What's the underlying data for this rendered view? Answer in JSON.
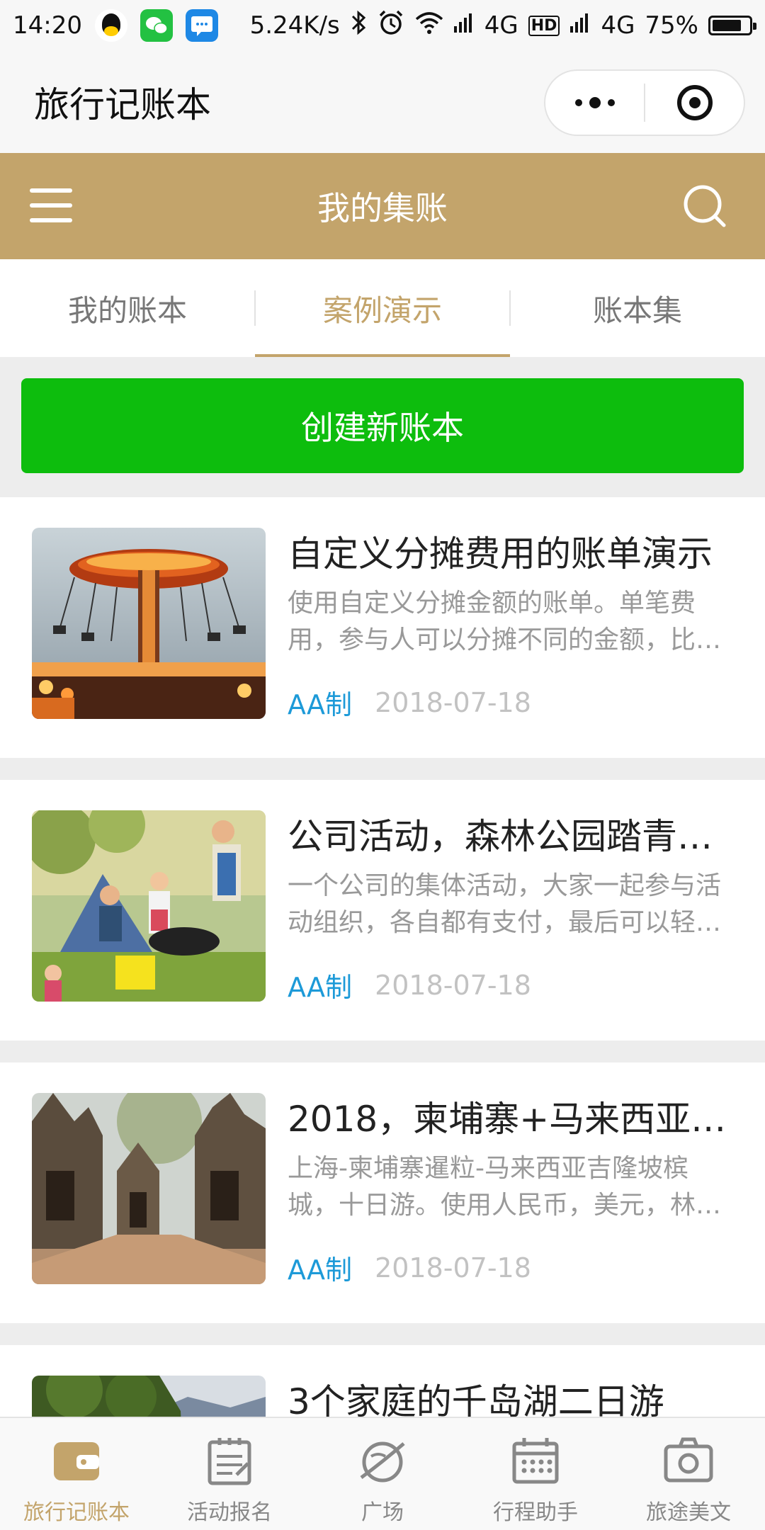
{
  "status_bar": {
    "time": "14:20",
    "net_speed": "5.24K/s",
    "network1": "4G",
    "hd_badge": "HD",
    "network2": "4G",
    "battery": "75%"
  },
  "mini_program": {
    "title": "旅行记账本"
  },
  "header": {
    "title": "我的集账"
  },
  "tabs": [
    {
      "label": "我的账本",
      "active": false
    },
    {
      "label": "案例演示",
      "active": true
    },
    {
      "label": "账本集",
      "active": false
    }
  ],
  "create_button": {
    "label": "创建新账本"
  },
  "cards": [
    {
      "title": "自定义分摊费用的账单演示",
      "desc": "使用自定义分摊金额的账单。单笔费用，参与人可以分摊不同的金额，比…",
      "tag": "AA制",
      "date": "2018-07-18",
      "image": "carnival-swing-ride"
    },
    {
      "title": "公司活动，森林公园踏青…",
      "desc": "一个公司的集体活动，大家一起参与活动组织，各自都有支付，最后可以轻…",
      "tag": "AA制",
      "date": "2018-07-18",
      "image": "family-picnic-bbq"
    },
    {
      "title": "2018，柬埔寨+马来西亚…",
      "desc": "上海-柬埔寨暹粒-马来西亚吉隆坡槟城，十日游。使用人民币，美元，林…",
      "tag": "AA制",
      "date": "2018-07-18",
      "image": "angkor-temple-ruins"
    },
    {
      "title": "3个家庭的千岛湖二日游",
      "desc": "",
      "tag": "",
      "date": "",
      "image": "lake-mountain-forest"
    }
  ],
  "tabbar": [
    {
      "label": "旅行记账本",
      "icon": "wallet-icon",
      "active": true
    },
    {
      "label": "活动报名",
      "icon": "clipboard-icon",
      "active": false
    },
    {
      "label": "广场",
      "icon": "planet-icon",
      "active": false
    },
    {
      "label": "行程助手",
      "icon": "calendar-icon",
      "active": false
    },
    {
      "label": "旅途美文",
      "icon": "camera-icon",
      "active": false
    }
  ],
  "colors": {
    "brand_gold": "#c3a46b",
    "create_green": "#0dbd0d",
    "tag_blue": "#1d9ad8",
    "date_gray": "#c2c2c2"
  }
}
